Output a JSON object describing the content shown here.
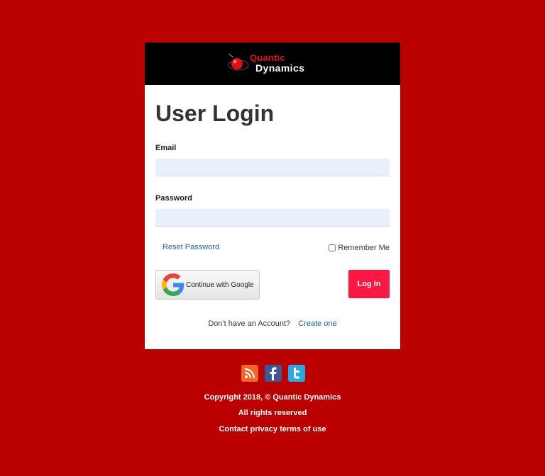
{
  "brand": {
    "line1": "Quantic",
    "line2": "Dynamics"
  },
  "login": {
    "title": "User Login",
    "email_label": "Email",
    "email_value": "",
    "password_label": "Password",
    "password_value": "",
    "reset_link": "Reset Password",
    "remember_label": "Remember Me",
    "remember_checked": false,
    "google_button": "Continue with Google",
    "login_button": "Log In",
    "no_account_text": "Don't have an Account?",
    "create_link": "Create one"
  },
  "social": [
    {
      "name": "rss-icon",
      "color": "#f26522"
    },
    {
      "name": "facebook-icon",
      "color": "#3b5998"
    },
    {
      "name": "twitter-icon",
      "color": "#29a9e1"
    }
  ],
  "footer": {
    "copyright": "Copyright 2018, © Quantic Dynamics",
    "rights": "All rights reserved",
    "links": [
      "Contact",
      "privacy",
      "terms of use"
    ]
  },
  "colors": {
    "page_background": "#bb0000",
    "header_background": "#000000",
    "login_button": "#ff1744",
    "link": "#1a5fb4"
  }
}
